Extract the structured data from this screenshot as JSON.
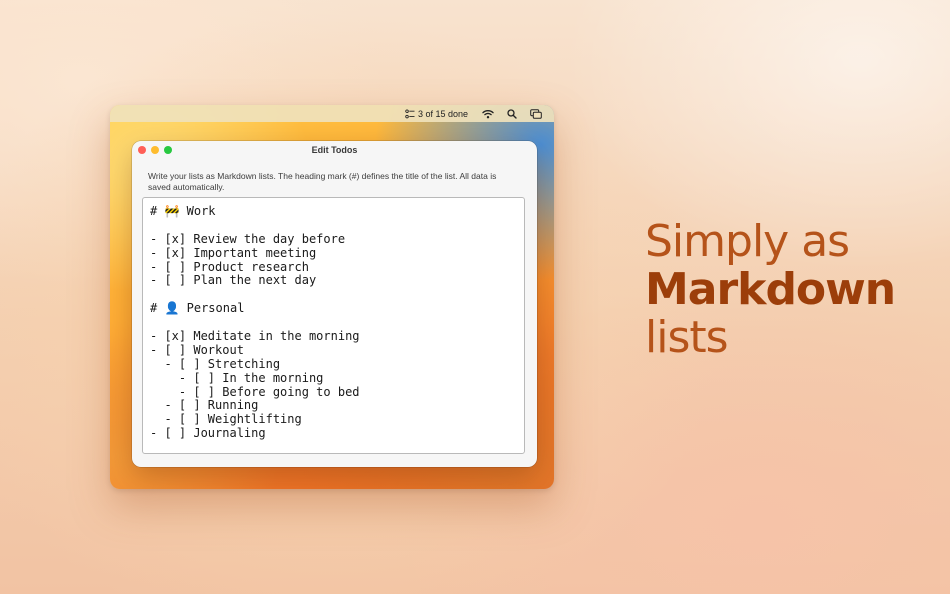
{
  "menubar": {
    "status_text": "3 of 15 done",
    "icons": [
      "checklist-icon",
      "wifi-icon",
      "search-icon",
      "control-center-icon"
    ]
  },
  "window": {
    "title": "Edit Todos",
    "description": "Write your lists as Markdown lists. The heading mark (#) defines the title of the list. All data is saved automatically.",
    "editor_lines": [
      "# 🚧 Work",
      "",
      "- [x] Review the day before",
      "- [x] Important meeting",
      "- [ ] Product research",
      "- [ ] Plan the next day",
      "",
      "# 👤 Personal",
      "",
      "- [x] Meditate in the morning",
      "- [ ] Workout",
      "  - [ ] Stretching",
      "    - [ ] In the morning",
      "    - [ ] Before going to bed",
      "  - [ ] Running",
      "  - [ ] Weightlifting",
      "- [ ] Journaling"
    ]
  },
  "headline": {
    "line1_a": "Simply as",
    "line2": "Markdown",
    "line3": "lists"
  },
  "colors": {
    "accent": "#b5531a",
    "accent_strong": "#9c3e0a"
  }
}
